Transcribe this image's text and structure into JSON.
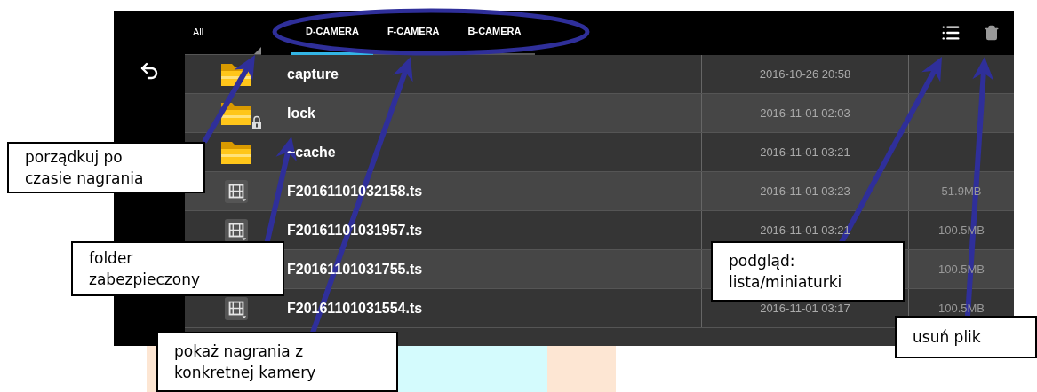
{
  "toolbar": {
    "sort_dropdown": "All",
    "tabs": [
      {
        "label": "D-CAMERA",
        "selected": true
      },
      {
        "label": "F-CAMERA",
        "selected": false
      },
      {
        "label": "B-CAMERA",
        "selected": false
      }
    ]
  },
  "files": [
    {
      "kind": "folder",
      "name": "capture",
      "locked": false,
      "date": "2016-10-26 20:58"
    },
    {
      "kind": "folder",
      "name": "lock",
      "locked": true,
      "date": "2016-11-01 02:03"
    },
    {
      "kind": "folder",
      "name": "~cache",
      "locked": false,
      "date": "2016-11-01 03:21"
    },
    {
      "kind": "video",
      "name": "F20161101032158.ts",
      "locked": false,
      "date": "2016-11-01 03:23",
      "size": "51.9MB"
    },
    {
      "kind": "video",
      "name": "F20161101031957.ts",
      "locked": false,
      "date": "2016-11-01 03:21",
      "size": "100.5MB"
    },
    {
      "name": "F20161101031755.ts",
      "locked": false,
      "size": "100.5MB"
    },
    {
      "kind": "video",
      "name": "F20161101031554.ts",
      "locked": false,
      "date": "2016-11-01 03:17",
      "size": "100.5MB"
    }
  ],
  "annotations": [
    {
      "lines": [
        "porządkuj po",
        "czasie nagrania"
      ]
    },
    {
      "lines": [
        "folder",
        "zabezpieczony"
      ]
    },
    {
      "lines": [
        "pokaż nagrania z",
        "konkretnej kamery"
      ]
    },
    {
      "lines": [
        "podgląd:",
        "lista/miniaturki"
      ]
    },
    {
      "lines": [
        "usuń plik"
      ]
    }
  ]
}
